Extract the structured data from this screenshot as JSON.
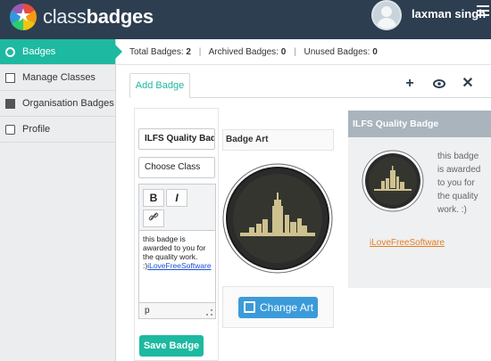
{
  "brand": {
    "light": "class",
    "bold": "badges"
  },
  "user": {
    "name": "laxman singh"
  },
  "sidebar": {
    "items": [
      {
        "label": "Badges",
        "icon": "badge-icon",
        "active": true
      },
      {
        "label": "Manage Classes",
        "icon": "classes-icon",
        "active": false
      },
      {
        "label": "Organisation Badges",
        "icon": "organisation-icon",
        "active": false
      },
      {
        "label": "Profile",
        "icon": "profile-icon",
        "active": false
      }
    ]
  },
  "stats": {
    "total": "Total Badges:",
    "total_value": "2",
    "archived": "Archived Badges:",
    "archived_value": "0",
    "unused": "Unused Badges:",
    "unused_value": "0"
  },
  "tabs": {
    "add_badge": "Add Badge"
  },
  "form": {
    "badge_name_value": "ILFS Quality Badge",
    "class_placeholder": "Choose Class",
    "description_text": "this badge is awarded to you for the quality work. :)",
    "description_link": "iLoveFreeSoftware",
    "editor_footer": "p",
    "save_label": "Save Badge",
    "bold_label": "B",
    "italic_label": "I"
  },
  "art": {
    "title": "Badge Art",
    "change_label": "Change Art"
  },
  "preview": {
    "title": "ILFS Quality Badge",
    "text": "this badge is awarded to you for the quality work. :)",
    "link": "iLoveFreeSoftware"
  },
  "colors": {
    "topbar": "#2d3e50",
    "accent": "#1db9a0",
    "button_blue": "#3b9bd9",
    "preview_head": "#a9b4bd",
    "link_orange": "#e67e22"
  }
}
